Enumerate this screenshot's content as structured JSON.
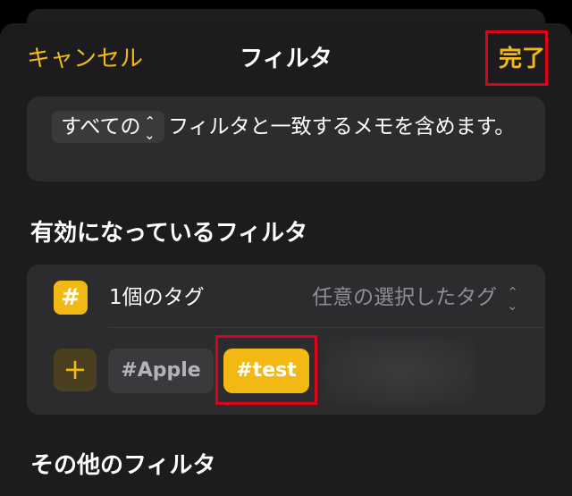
{
  "nav": {
    "cancel_label": "キャンセル",
    "title": "フィルタ",
    "done_label": "完了"
  },
  "match": {
    "select_value": "すべての",
    "sentence": "フィルタと一致するメモを含めます。"
  },
  "sections": {
    "active_title": "有効になっているフィルタ",
    "other_title": "その他のフィルタ"
  },
  "tag_filter": {
    "badge_symbol": "#",
    "count_label": "1個のタグ",
    "mode_label": "任意の選択したタグ",
    "add_symbol": "+",
    "tags": [
      "#Apple",
      "#test"
    ]
  },
  "colors": {
    "accent": "#f2b915",
    "highlight": "#e0001a",
    "card": "#2c2c2e",
    "sheet": "#1c1c1e"
  }
}
